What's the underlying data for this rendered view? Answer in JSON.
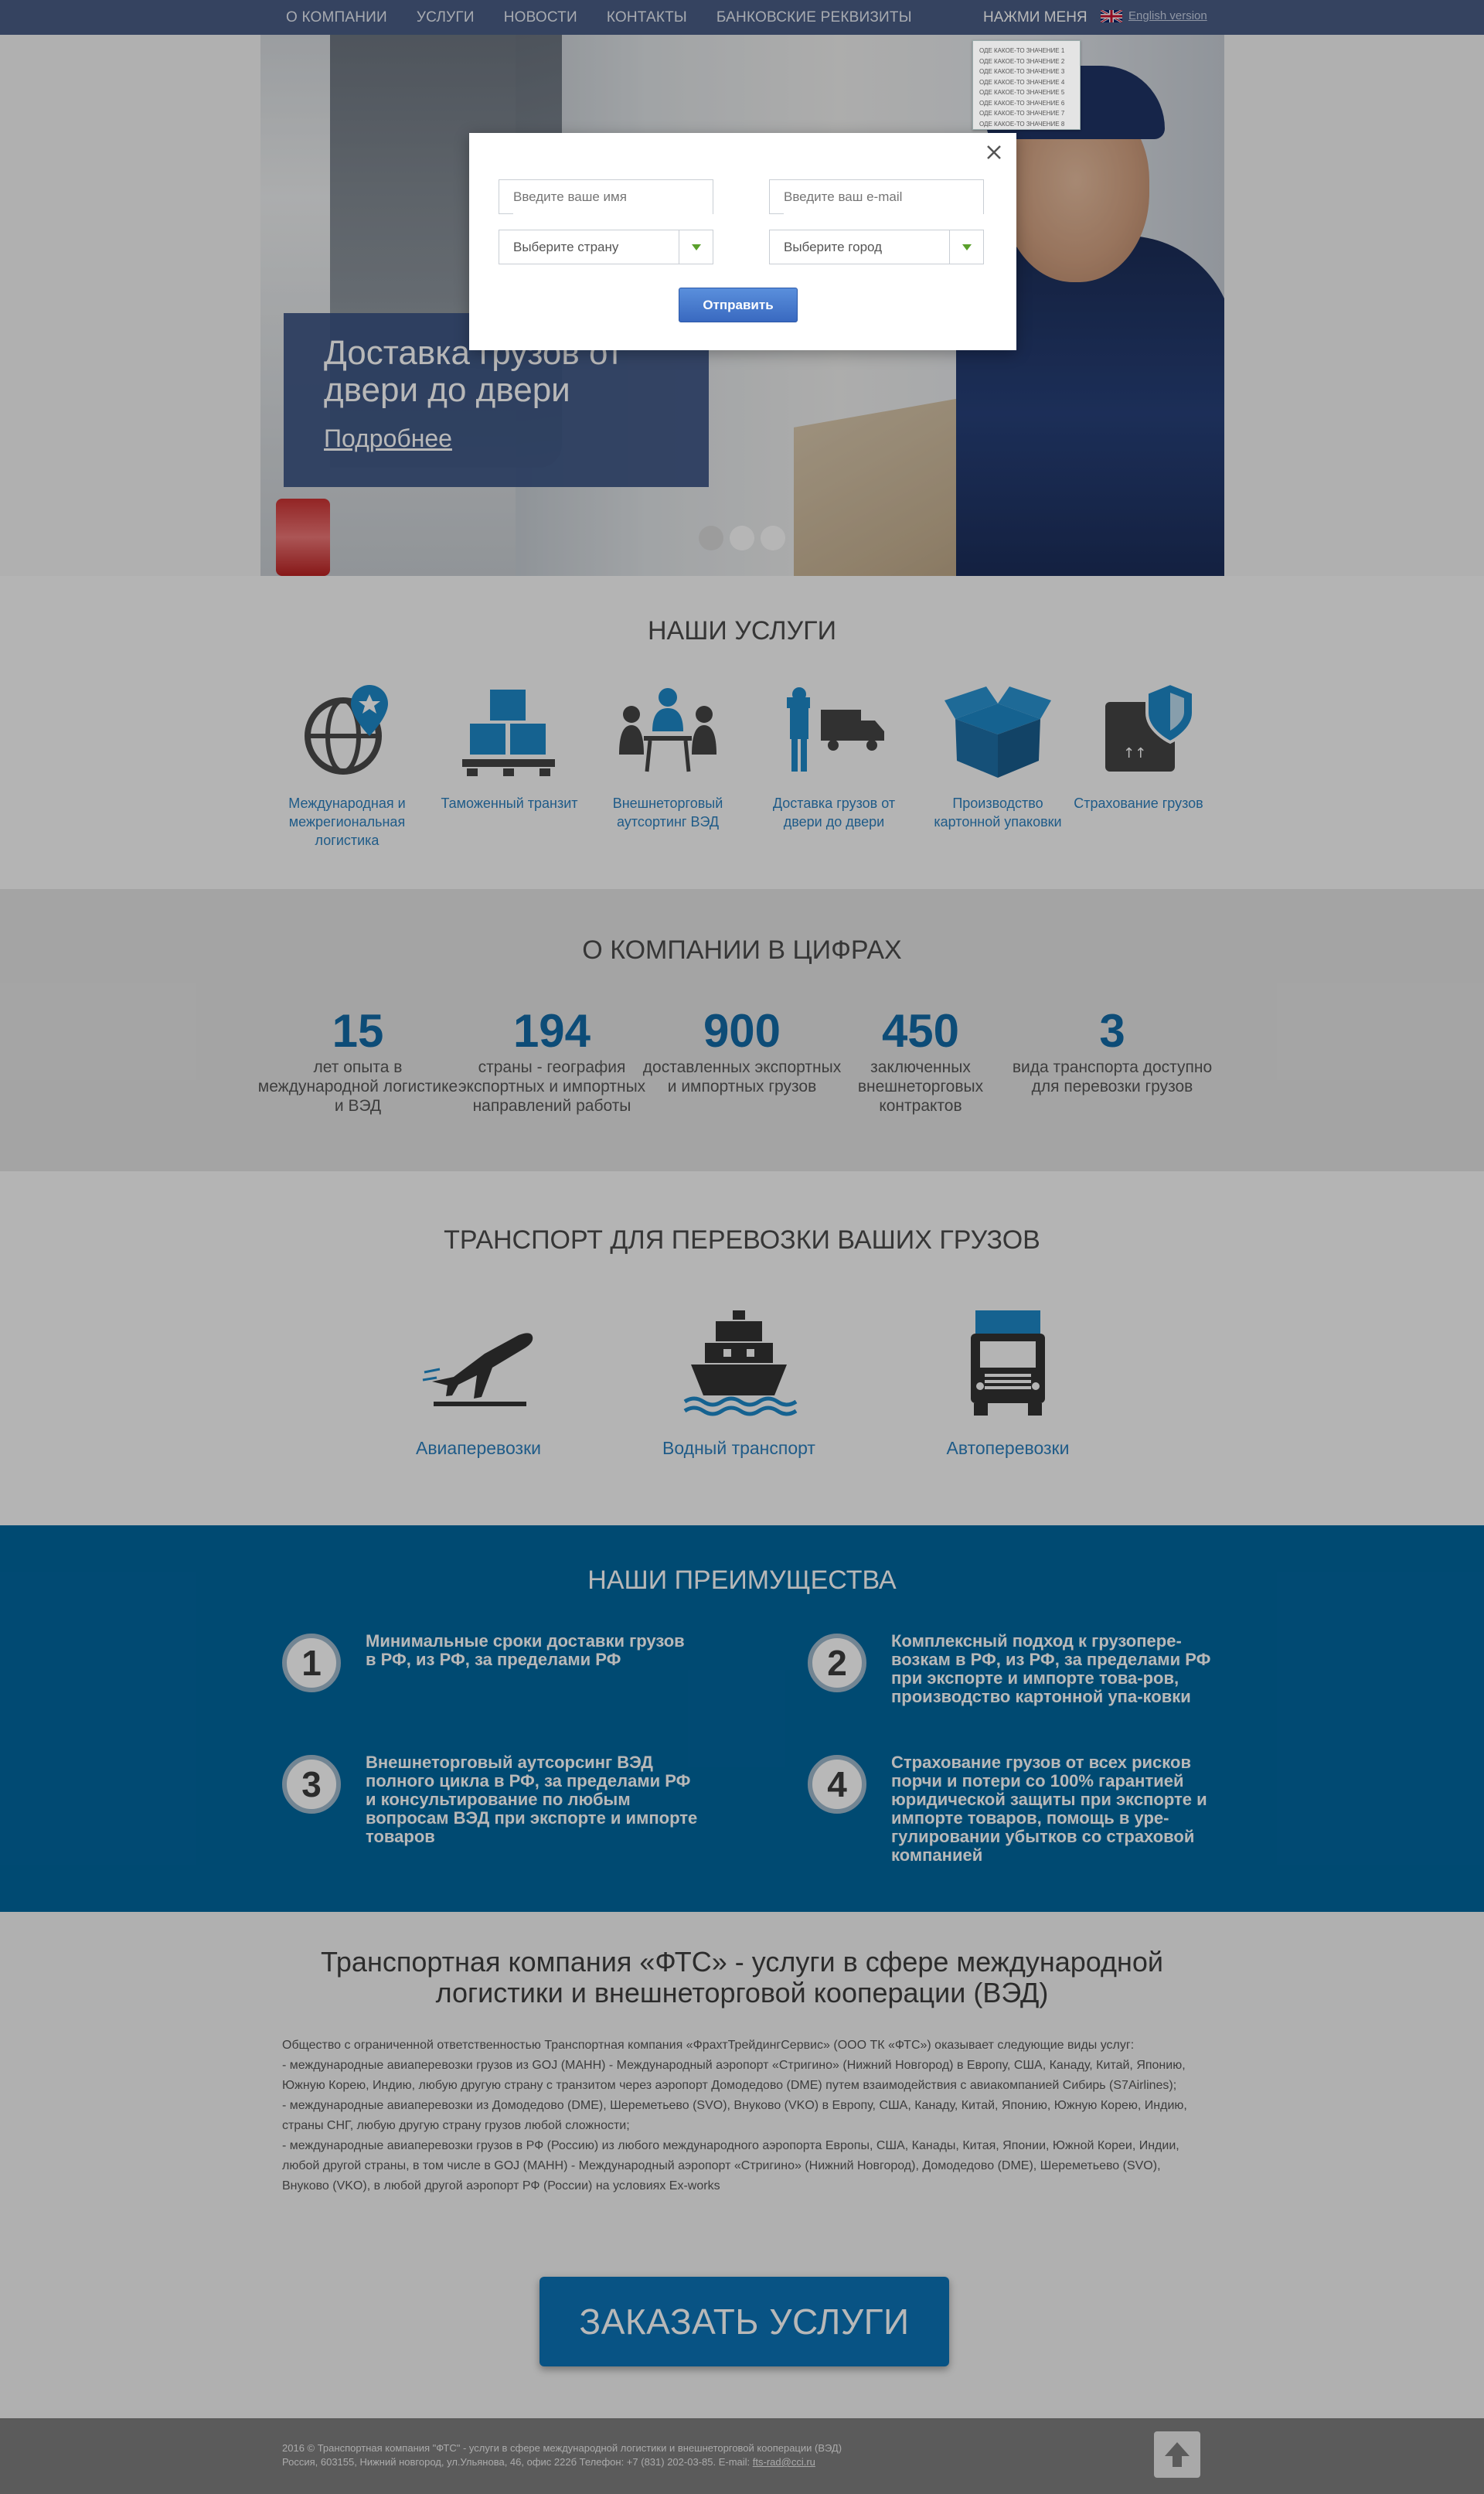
{
  "nav": {
    "items": [
      "О компании",
      "Услуги",
      "Новости",
      "Контакты",
      "Банковские реквизиты"
    ],
    "press_me": "НАЖМИ МЕНЯ",
    "english": "English version"
  },
  "dropdown": {
    "items": [
      "ОДЕ КАКОЕ-ТО ЗНАЧЕНИЕ 1",
      "ОДЕ КАКОЕ-ТО ЗНАЧЕНИЕ 2",
      "ОДЕ КАКОЕ-ТО ЗНАЧЕНИЕ 3",
      "ОДЕ КАКОЕ-ТО ЗНАЧЕНИЕ 4",
      "ОДЕ КАКОЕ-ТО ЗНАЧЕНИЕ 5",
      "ОДЕ КАКОЕ-ТО ЗНАЧЕНИЕ 6",
      "ОДЕ КАКОЕ-ТО ЗНАЧЕНИЕ 7",
      "ОДЕ КАКОЕ-ТО ЗНАЧЕНИЕ 8"
    ]
  },
  "hero": {
    "title": "Доставка грузов от двери до двери",
    "more": "Подробнее"
  },
  "modal": {
    "name_placeholder": "Введите ваше имя",
    "email_placeholder": "Введите ваш e-mail",
    "country_placeholder": "Выберите страну",
    "city_placeholder": "Выберите город",
    "submit": "Отправить"
  },
  "services": {
    "title": "НАШИ УСЛУГИ",
    "items": [
      {
        "label": "Международная и межрегиональная логистика",
        "icon": "globe-pin-icon"
      },
      {
        "label": "Таможенный транзит",
        "icon": "boxes-pallet-icon"
      },
      {
        "label": "Внешнеторговый аутсортинг ВЭД",
        "icon": "meeting-icon"
      },
      {
        "label": "Доставка грузов от двери до двери",
        "icon": "courier-truck-icon"
      },
      {
        "label": "Производство картонной упаковки",
        "icon": "open-box-icon"
      },
      {
        "label": "Страхование грузов",
        "icon": "shield-box-icon"
      }
    ]
  },
  "stats": {
    "title": "О КОМПАНИИ В ЦИФРАХ",
    "items": [
      {
        "num": "15",
        "text": "лет опыта в международной логистике и ВЭД"
      },
      {
        "num": "194",
        "text": "страны - география экспортных и импортных направлений работы"
      },
      {
        "num": "900",
        "text": "доставленных экспортных и импортных грузов"
      },
      {
        "num": "450",
        "text": "заключенных внешнеторговых контрактов"
      },
      {
        "num": "3",
        "text": "вида транспорта доступно для перевозки грузов"
      }
    ]
  },
  "transport": {
    "title": "ТРАНСПОРТ ДЛЯ ПЕРЕВОЗКИ ВАШИХ ГРУЗОВ",
    "items": [
      {
        "label": "Авиаперевозки",
        "icon": "plane-icon"
      },
      {
        "label": "Водный транспорт",
        "icon": "ship-icon"
      },
      {
        "label": "Автоперевозки",
        "icon": "truck-icon"
      }
    ]
  },
  "advantages": {
    "title": "НАШИ ПРЕИМУЩЕСТВА",
    "items": [
      {
        "num": "1",
        "text": "Минимальные сроки доставки грузов в РФ, из РФ, за пределами РФ"
      },
      {
        "num": "2",
        "text": "Комплексный подход к грузопере-возкам в РФ, из РФ, за пределами РФ при экспорте и импорте това-ров, производство картонной упа-ковки"
      },
      {
        "num": "3",
        "text": "Внешнеторговый аутсорсинг ВЭД полного цикла в РФ, за пределами РФ и консультирование по любым вопросам ВЭД при экспорте и импорте товаров"
      },
      {
        "num": "4",
        "text": "Страхование грузов от всех рисков порчи и потери со 100% гарантией юридической защиты при экспорте и импорте товаров, помощь в уре-гулировании убытков со страховой компанией"
      }
    ]
  },
  "about": {
    "title": "Транспортная компания «ФТС» - услуги в сфере международной логистики и внешнеторговой кооперации (ВЭД)",
    "paragraphs": [
      "Общество с ограниченной ответственностью Транспортная компания «ФрахтТрейдингСервис» (ООО ТК «ФТС») оказывает следующие виды услуг:",
      "- международные авиаперевозки грузов из GOJ (МАНН) - Международный аэропорт «Стригино» (Нижний Новгород) в Европу, США, Канаду, Китай, Японию, Южную Корею, Индию, любую другую страну с транзитом через аэропорт Домодедово (DME) путем взаимодействия с авиакомпанией Сибирь (S7Airlines);",
      "- международные авиаперевозки из Домодедово (DME), Шереметьево (SVO), Внуково (VKO) в Европу, США, Канаду, Китай, Японию, Южную Корею, Индию, страны СНГ, любую другую страну грузов любой сложности;",
      "- международные авиаперевозки грузов в РФ (Россию) из любого международного аэропорта Европы, США, Канады, Китая, Японии, Южной Кореи, Индии, любой другой страны, в том числе в GOJ (МАНН) - Международный аэропорт «Стригино» (Нижний Новгород), Домодедово (DME), Шереметьево (SVO), Внуково (VKO), в любой другой аэропорт РФ (России) на условиях Ex-works"
    ],
    "order_button": "ЗАКАЗАТЬ УСЛУГИ"
  },
  "footer": {
    "line1": "2016 © Транспортная компания \"ФТС\" - услуги в сфере международной логистики и внешнеторговой кооперации (ВЭД)",
    "line2": "Россия, 603155, Нижний новгород, ул.Ульянова, 46, офис 222б Телефон: +7 (831) 202-03-85. E-mail:",
    "email": "fts-rad@cci.ru"
  },
  "colors": {
    "nav_bg": "#4a5e86",
    "accent_blue": "#136aa6",
    "advantages_bg": "#01679f",
    "order_button": "#0c74b7"
  }
}
